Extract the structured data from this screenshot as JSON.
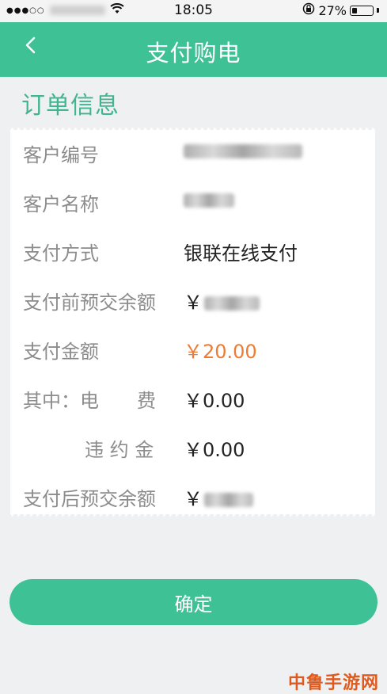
{
  "status_bar": {
    "time": "18:05",
    "battery": "27%",
    "battery_level": 0.27,
    "signal_dots": "●●●○○",
    "wifi_icon": "wifi-icon"
  },
  "header": {
    "title": "支付购电",
    "back_icon": "chevron-left-icon"
  },
  "section_title": "订单信息",
  "order": {
    "customer_id_label": "客户编号",
    "customer_name_label": "客户名称",
    "pay_method_label": "支付方式",
    "pay_method_value": "银联在线支付",
    "balance_before_label": "支付前预交余额",
    "currency_symbol": "￥",
    "amount_label": "支付金额",
    "amount_value": "￥20.00",
    "electricity_label": "其中：电　　费",
    "electricity_value": "￥0.00",
    "penalty_label": "违 约 金",
    "penalty_value": "￥0.00",
    "balance_after_label": "支付后预交余额"
  },
  "confirm_label": "确定",
  "watermark": "中鲁手游网",
  "colors": {
    "accent": "#3fc196",
    "amount": "#f07a33",
    "label": "#8c8c8c"
  }
}
